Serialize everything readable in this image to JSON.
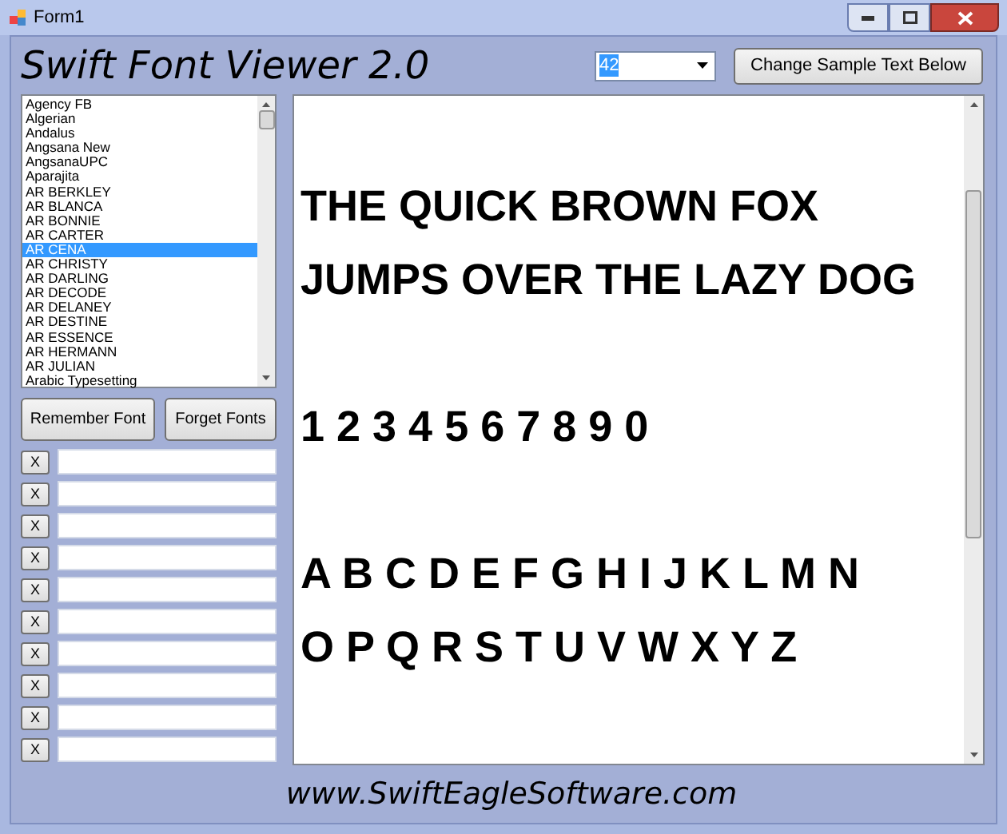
{
  "window": {
    "title": "Form1"
  },
  "app_title": "Swift Font Viewer 2.0",
  "size_field": {
    "value": "42"
  },
  "change_button": "Change Sample Text Below",
  "font_list": [
    {
      "label": "Agency FB",
      "selected": false
    },
    {
      "label": "Algerian",
      "selected": false
    },
    {
      "label": "Andalus",
      "selected": false
    },
    {
      "label": "Angsana New",
      "selected": false
    },
    {
      "label": "AngsanaUPC",
      "selected": false
    },
    {
      "label": "Aparajita",
      "selected": false
    },
    {
      "label": "AR BERKLEY",
      "selected": false
    },
    {
      "label": "AR BLANCA",
      "selected": false
    },
    {
      "label": "AR BONNIE",
      "selected": false
    },
    {
      "label": "AR CARTER",
      "selected": false
    },
    {
      "label": "AR CENA",
      "selected": true
    },
    {
      "label": "AR CHRISTY",
      "selected": false
    },
    {
      "label": "AR DARLING",
      "selected": false
    },
    {
      "label": "AR DECODE",
      "selected": false
    },
    {
      "label": "AR DELANEY",
      "selected": false
    },
    {
      "label": "AR DESTINE",
      "selected": false
    },
    {
      "label": "AR ESSENCE",
      "selected": false
    },
    {
      "label": "AR HERMANN",
      "selected": false
    },
    {
      "label": "AR JULIAN",
      "selected": false
    },
    {
      "label": "Arabic Typesetting",
      "selected": false
    }
  ],
  "remember_button": "Remember Font",
  "forget_button": "Forget Fonts",
  "remembered_fonts": [
    {
      "clear": "X"
    },
    {
      "clear": "X"
    },
    {
      "clear": "X"
    },
    {
      "clear": "X"
    },
    {
      "clear": "X"
    },
    {
      "clear": "X"
    },
    {
      "clear": "X"
    },
    {
      "clear": "X"
    },
    {
      "clear": "X"
    },
    {
      "clear": "X"
    }
  ],
  "sample_lines": [
    {
      "kind": "text",
      "text": "THE QUICK BROWN FOX"
    },
    {
      "kind": "text",
      "text": "JUMPS OVER THE LAZY DOG"
    },
    {
      "kind": "blank"
    },
    {
      "kind": "text",
      "text": "1 2 3 4 5 6 7 8 9 0"
    },
    {
      "kind": "blank"
    },
    {
      "kind": "text",
      "text": "A B C D E F G H I J K L M N"
    },
    {
      "kind": "text",
      "text": "O P Q R S T U V W X Y Z"
    }
  ],
  "footer": "www.SwiftEagleSoftware.com"
}
